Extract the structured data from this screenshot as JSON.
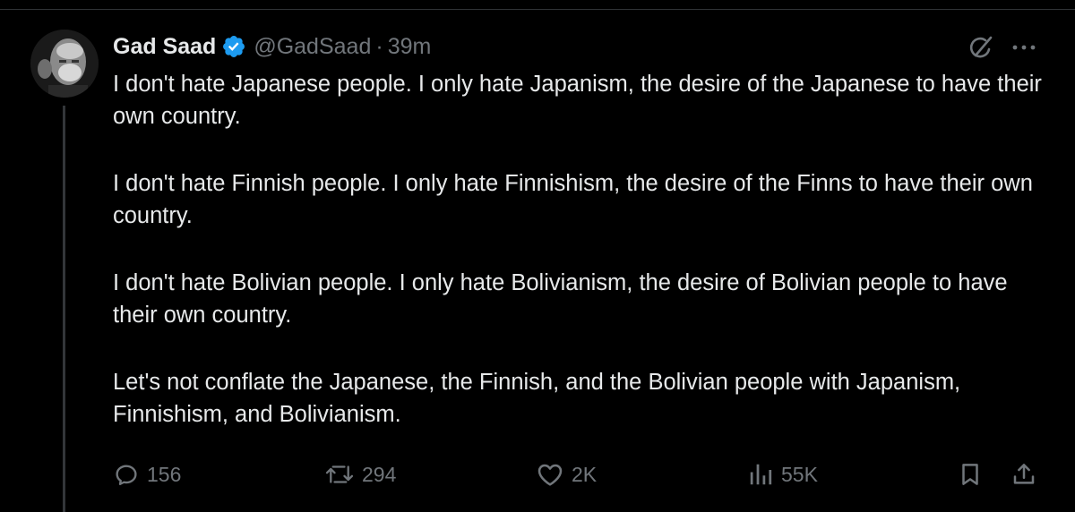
{
  "author": {
    "display_name": "Gad Saad",
    "handle": "@GadSaad",
    "separator": "·",
    "time": "39m",
    "verified": true
  },
  "tweet": {
    "paragraphs": [
      "I don't hate Japanese people.  I only hate Japanism, the desire of the Japanese to have their own country.",
      "I don't hate Finnish people.  I only hate Finnishism, the desire of the Finns to have their own country.",
      "I don't hate Bolivian people.  I only hate Bolivianism, the desire of Bolivian people to have their own country.",
      "Let's not conflate the Japanese, the Finnish, and the Bolivian people with Japanism, Finnishism, and Bolivianism."
    ]
  },
  "actions": {
    "replies": "156",
    "reposts": "294",
    "likes": "2K",
    "views": "55K"
  },
  "icons": {
    "verified": "verified-badge-icon",
    "grok": "grok-icon",
    "more": "more-icon",
    "reply": "reply-icon",
    "repost": "repost-icon",
    "like": "heart-icon",
    "views": "views-icon",
    "bookmark": "bookmark-icon",
    "share": "share-icon"
  },
  "colors": {
    "background": "#000000",
    "text": "#e7e9ea",
    "secondary": "#71767b",
    "verified": "#1d9bf0"
  }
}
